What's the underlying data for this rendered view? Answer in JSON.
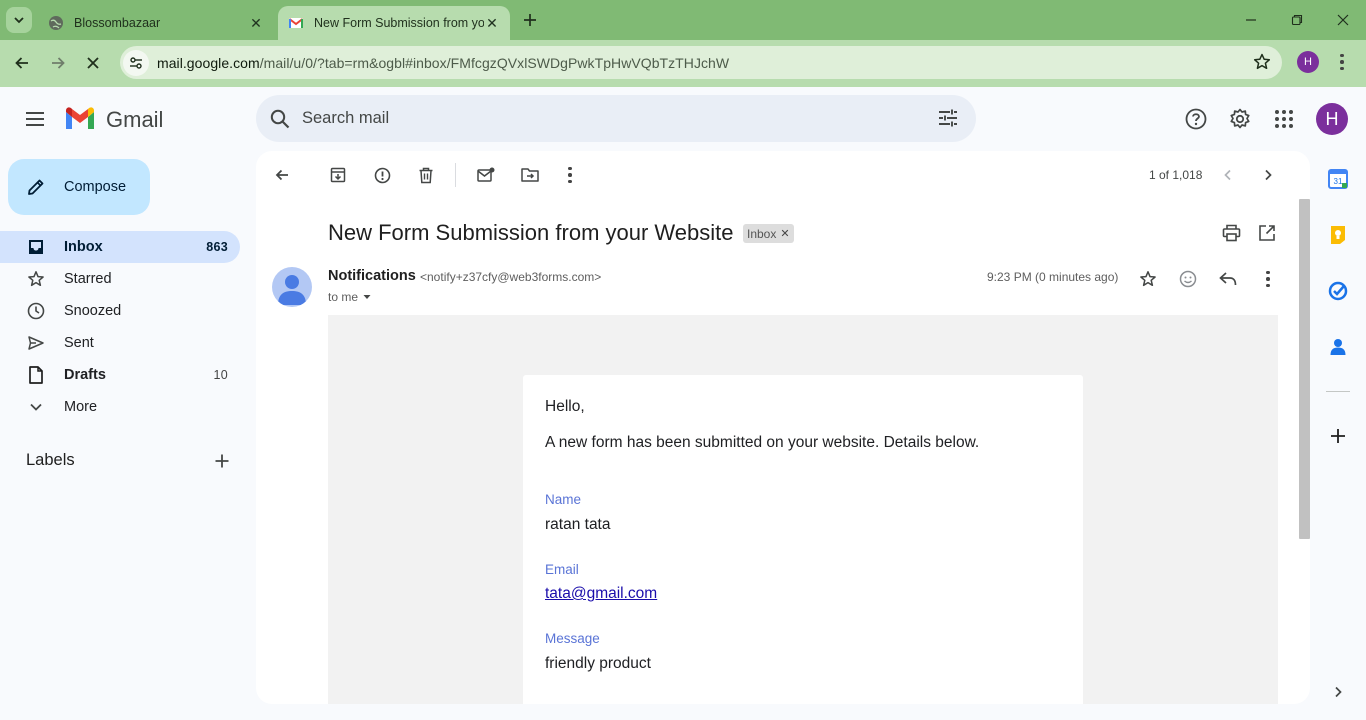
{
  "browser": {
    "tabs": [
      {
        "title": "Blossombazaar",
        "active": false
      },
      {
        "title": "New Form Submission from your",
        "active": true
      }
    ],
    "url_host": "mail.google.com",
    "url_path": "/mail/u/0/?tab=rm&ogbl#inbox/FMfcgzQVxlSWDgPwkTpHwVQbTzTHJchW",
    "profile_initial": "H",
    "theme_color": "#80ba74"
  },
  "gmail": {
    "logo_text": "Gmail",
    "search_placeholder": "Search mail",
    "account_initial": "H",
    "compose_label": "Compose",
    "nav": [
      {
        "label": "Inbox",
        "count": "863",
        "icon": "inbox-icon",
        "active": true
      },
      {
        "label": "Starred",
        "count": "",
        "icon": "star-icon"
      },
      {
        "label": "Snoozed",
        "count": "",
        "icon": "clock-icon"
      },
      {
        "label": "Sent",
        "count": "",
        "icon": "send-icon"
      },
      {
        "label": "Drafts",
        "count": "10",
        "icon": "draft-icon"
      },
      {
        "label": "More",
        "count": "",
        "icon": "chevron-down-icon"
      }
    ],
    "labels_heading": "Labels"
  },
  "message": {
    "pager": "1 of 1,018",
    "subject": "New Form Submission from your Website",
    "label_chip": "Inbox",
    "sender_name": "Notifications",
    "sender_email": "<notify+z37cfy@web3forms.com>",
    "recipient": "to me",
    "time": "9:23 PM (0 minutes ago)",
    "body": {
      "greeting": "Hello,",
      "intro": "A new form has been submitted on your website. Details below.",
      "fields": [
        {
          "label": "Name",
          "value": "ratan tata"
        },
        {
          "label": "Email",
          "value": "tata@gmail.com"
        },
        {
          "label": "Message",
          "value": "friendly product"
        }
      ]
    }
  }
}
